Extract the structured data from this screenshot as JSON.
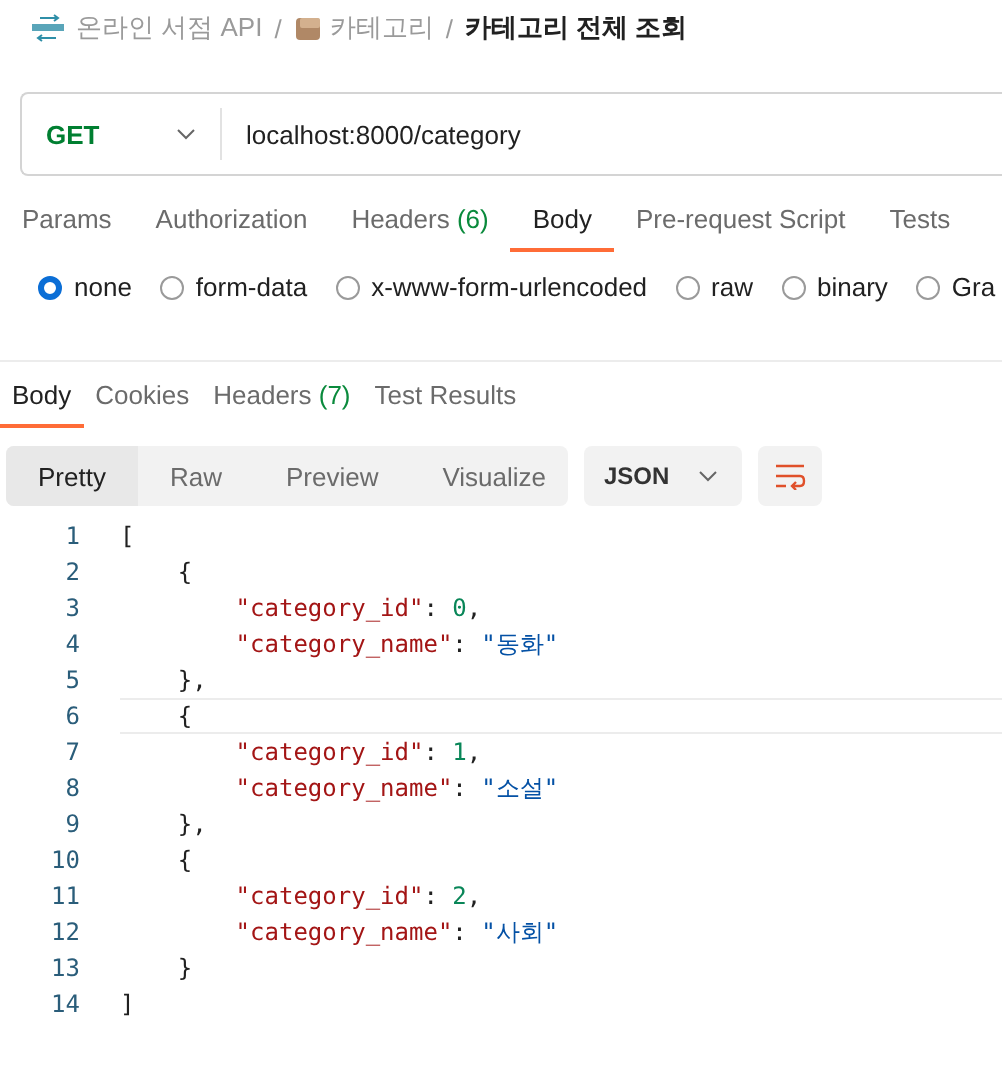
{
  "breadcrumb": {
    "items": [
      {
        "kind": "collection",
        "text": "온라인 서점 API"
      },
      {
        "kind": "folder",
        "text": "카테고리"
      },
      {
        "kind": "current",
        "text": "카테고리 전체 조회"
      }
    ],
    "separator": "/"
  },
  "request": {
    "method": "GET",
    "url": "localhost:8000/category"
  },
  "request_tabs": [
    {
      "label": "Params",
      "selected": false
    },
    {
      "label": "Authorization",
      "selected": false
    },
    {
      "label": "Headers",
      "count": "(6)",
      "selected": false
    },
    {
      "label": "Body",
      "selected": true
    },
    {
      "label": "Pre-request Script",
      "selected": false
    },
    {
      "label": "Tests",
      "selected": false
    }
  ],
  "body_types": [
    {
      "label": "none",
      "selected": true
    },
    {
      "label": "form-data",
      "selected": false
    },
    {
      "label": "x-www-form-urlencoded",
      "selected": false
    },
    {
      "label": "raw",
      "selected": false
    },
    {
      "label": "binary",
      "selected": false
    },
    {
      "label": "Gra",
      "selected": false
    }
  ],
  "response_tabs": [
    {
      "label": "Body",
      "selected": true
    },
    {
      "label": "Cookies",
      "selected": false
    },
    {
      "label": "Headers",
      "count": "(7)",
      "selected": false
    },
    {
      "label": "Test Results",
      "selected": false
    }
  ],
  "view_modes": [
    {
      "label": "Pretty",
      "selected": true
    },
    {
      "label": "Raw",
      "selected": false
    },
    {
      "label": "Preview",
      "selected": false
    },
    {
      "label": "Visualize",
      "selected": false
    }
  ],
  "format": "JSON",
  "code_lines": [
    {
      "number": "1",
      "current": false,
      "tokens": [
        {
          "kind": "punct",
          "text": "["
        }
      ]
    },
    {
      "number": "2",
      "current": false,
      "tokens": [
        {
          "kind": "punct",
          "text": "    {"
        }
      ]
    },
    {
      "number": "3",
      "current": false,
      "tokens": [
        {
          "kind": "key",
          "text": "        \"category_id\""
        },
        {
          "kind": "punct",
          "text": ": "
        },
        {
          "kind": "number",
          "text": "0"
        },
        {
          "kind": "punct",
          "text": ","
        }
      ]
    },
    {
      "number": "4",
      "current": false,
      "tokens": [
        {
          "kind": "key",
          "text": "        \"category_name\""
        },
        {
          "kind": "punct",
          "text": ": "
        },
        {
          "kind": "string",
          "text": "\"동화\""
        }
      ]
    },
    {
      "number": "5",
      "current": false,
      "tokens": [
        {
          "kind": "punct",
          "text": "    },"
        }
      ]
    },
    {
      "number": "6",
      "current": true,
      "tokens": [
        {
          "kind": "punct",
          "text": "    {"
        }
      ]
    },
    {
      "number": "7",
      "current": false,
      "tokens": [
        {
          "kind": "key",
          "text": "        \"category_id\""
        },
        {
          "kind": "punct",
          "text": ": "
        },
        {
          "kind": "number",
          "text": "1"
        },
        {
          "kind": "punct",
          "text": ","
        }
      ]
    },
    {
      "number": "8",
      "current": false,
      "tokens": [
        {
          "kind": "key",
          "text": "        \"category_name\""
        },
        {
          "kind": "punct",
          "text": ": "
        },
        {
          "kind": "string",
          "text": "\"소설\""
        }
      ]
    },
    {
      "number": "9",
      "current": false,
      "tokens": [
        {
          "kind": "punct",
          "text": "    },"
        }
      ]
    },
    {
      "number": "10",
      "current": false,
      "tokens": [
        {
          "kind": "punct",
          "text": "    {"
        }
      ]
    },
    {
      "number": "11",
      "current": false,
      "tokens": [
        {
          "kind": "key",
          "text": "        \"category_id\""
        },
        {
          "kind": "punct",
          "text": ": "
        },
        {
          "kind": "number",
          "text": "2"
        },
        {
          "kind": "punct",
          "text": ","
        }
      ]
    },
    {
      "number": "12",
      "current": false,
      "tokens": [
        {
          "kind": "key",
          "text": "        \"category_name\""
        },
        {
          "kind": "punct",
          "text": ": "
        },
        {
          "kind": "string",
          "text": "\"사회\""
        }
      ]
    },
    {
      "number": "13",
      "current": false,
      "tokens": [
        {
          "kind": "punct",
          "text": "    }"
        }
      ]
    },
    {
      "number": "14",
      "current": false,
      "tokens": [
        {
          "kind": "punct",
          "text": "]"
        }
      ]
    }
  ]
}
